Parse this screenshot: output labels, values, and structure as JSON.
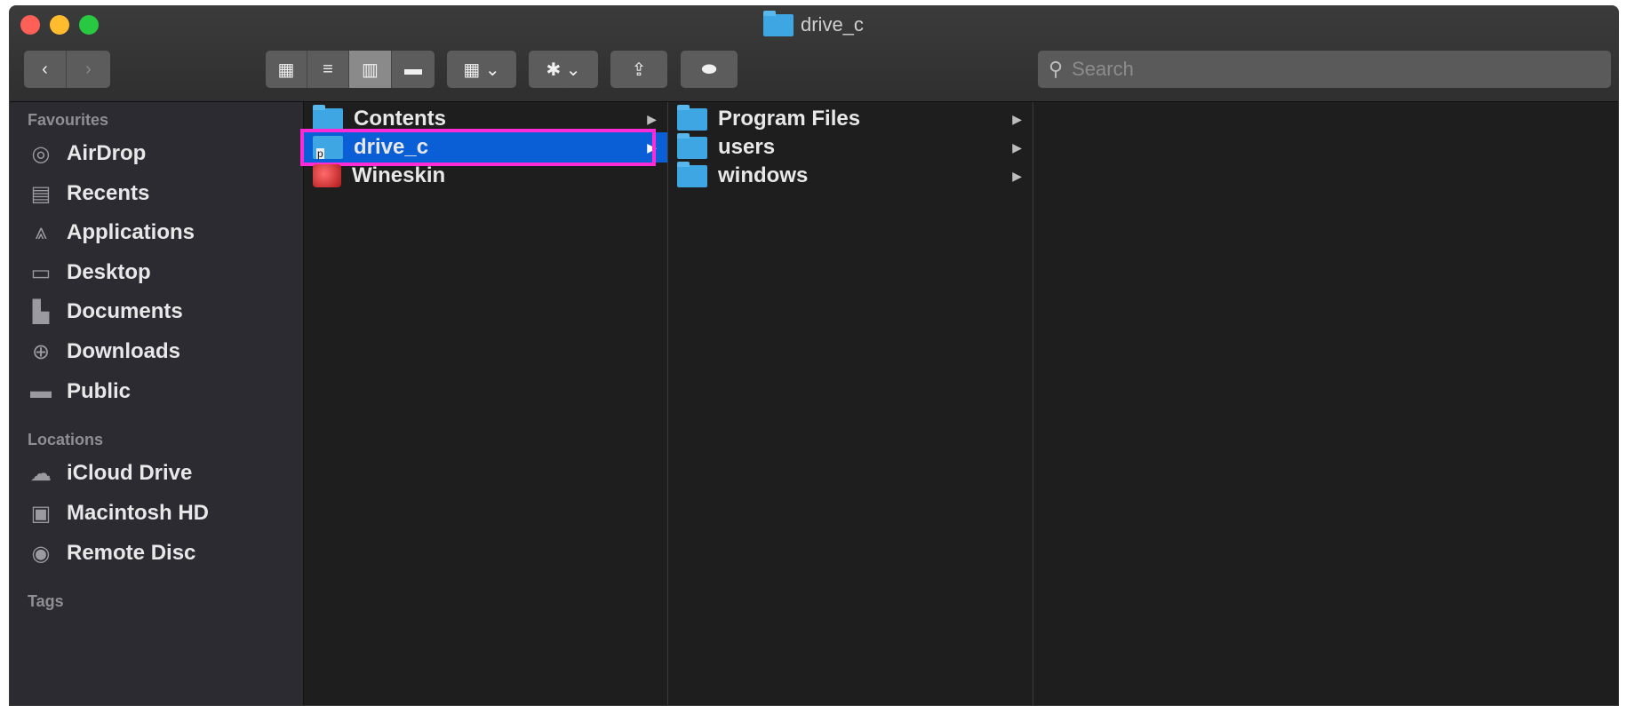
{
  "window": {
    "title": "drive_c",
    "controls": [
      "close",
      "minimize",
      "zoom"
    ]
  },
  "toolbar": {
    "back": "‹",
    "forward": "›",
    "view_icon": "▦",
    "view_list": "≡",
    "view_columns": "▥",
    "view_gallery": "▬",
    "group_label": "▦ ⌄",
    "action_label": "✱ ⌄",
    "share_label": "⇪",
    "tag_label": "⬬"
  },
  "search": {
    "placeholder": "Search",
    "icon": "search-icon"
  },
  "sidebar": {
    "favourites_heading": "Favourites",
    "favourites": [
      {
        "label": "AirDrop",
        "icon": "airdrop-icon"
      },
      {
        "label": "Recents",
        "icon": "recents-icon"
      },
      {
        "label": "Applications",
        "icon": "applications-icon"
      },
      {
        "label": "Desktop",
        "icon": "desktop-icon"
      },
      {
        "label": "Documents",
        "icon": "documents-icon"
      },
      {
        "label": "Downloads",
        "icon": "downloads-icon"
      },
      {
        "label": "Public",
        "icon": "folder-icon"
      }
    ],
    "locations_heading": "Locations",
    "locations": [
      {
        "label": "iCloud Drive",
        "icon": "cloud-icon"
      },
      {
        "label": "Macintosh HD",
        "icon": "disk-icon"
      },
      {
        "label": "Remote Disc",
        "icon": "disc-icon"
      }
    ],
    "tags_heading": "Tags"
  },
  "columns": {
    "col1": [
      {
        "label": "Contents",
        "icon": "folder-icon",
        "has_children": true
      },
      {
        "label": "drive_c",
        "icon": "folder-icon",
        "has_children": true,
        "selected": true
      },
      {
        "label": "Wineskin",
        "icon": "app-icon",
        "has_children": false
      }
    ],
    "col2": [
      {
        "label": "Program Files",
        "icon": "folder-icon",
        "has_children": true
      },
      {
        "label": "users",
        "icon": "folder-icon",
        "has_children": true
      },
      {
        "label": "windows",
        "icon": "folder-icon",
        "has_children": true
      }
    ]
  },
  "colors": {
    "selection": "#0a5fd6",
    "highlight_box": "#ff2bd6",
    "folder": "#3ea6e2"
  }
}
